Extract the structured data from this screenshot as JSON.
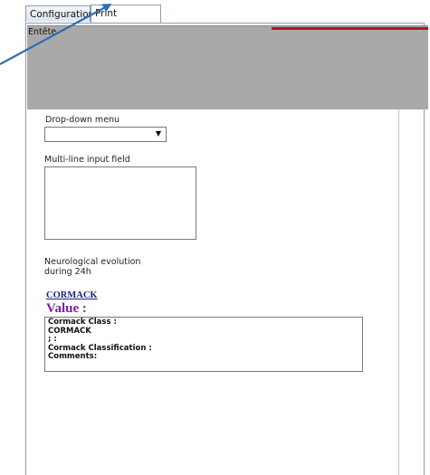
{
  "tabs": [
    {
      "label": "Configuration",
      "selected": false
    },
    {
      "label": "Print preview",
      "selected": true
    }
  ],
  "header": {
    "label": "Entête"
  },
  "form": {
    "dropdown": {
      "label": "Drop-down menu",
      "value": ""
    },
    "multiline": {
      "label": "Multi-line input field",
      "value": ""
    },
    "neuro": {
      "line1": "Neurological evolution",
      "line2": "during 24h"
    }
  },
  "cormack": {
    "link": "CORMACK",
    "value_title": "Value :",
    "lines": [
      "Cormack Class :",
      "CORMACK",
      "; :",
      "Cormack Classification :",
      "Comments:"
    ]
  },
  "colors": {
    "header_bg": "#a9a9a9",
    "header_accent": "#b01818",
    "link": "#1a237e",
    "value_title": "#7b1fa2",
    "annotation_arrow": "#2f6db5"
  }
}
